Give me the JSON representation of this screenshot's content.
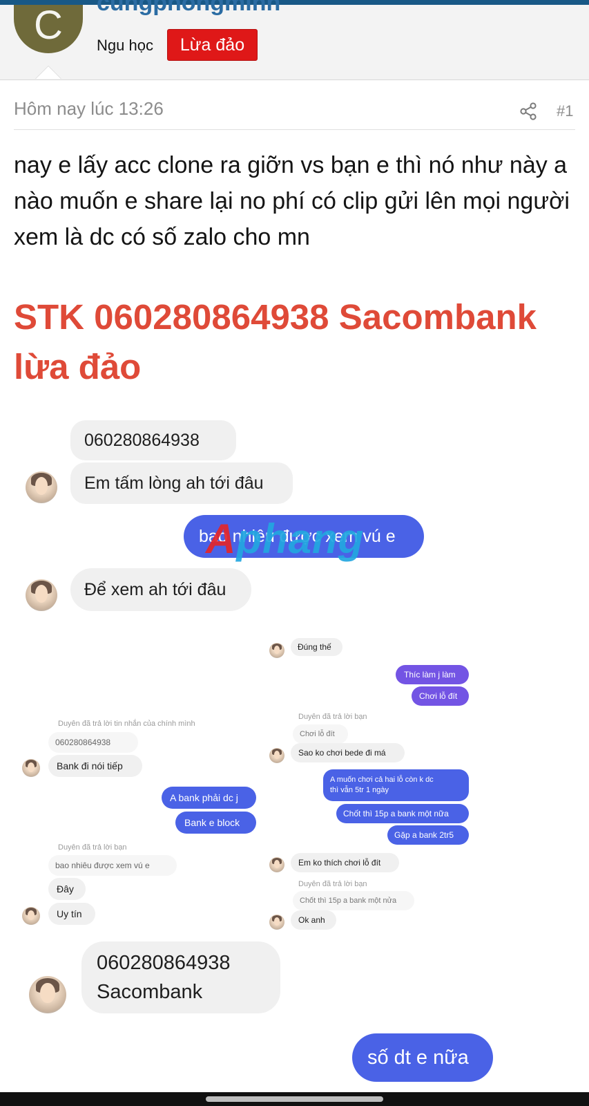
{
  "colors": {
    "topbar": "#185886",
    "badge": "#df1818",
    "headline": "#df4a38",
    "bubble_purple": "#7354e4",
    "bubble_blue": "#4a62e6",
    "bubble_gray": "#f0f0f0"
  },
  "user": {
    "avatar_letter": "C",
    "name": "cungphongminh",
    "title": "Ngu học",
    "badge": "Lừa đảo"
  },
  "post": {
    "timestamp": "Hôm nay lúc 13:26",
    "number": "#1",
    "body": "nay e lấy acc clone ra giỡn vs bạn e thì nó như này a nào muốn e share lại no phí có clip gửi lên mọi người xem là dc có số zalo cho mn",
    "headline": "STK 060280864938 Sacombank lừa đảo"
  },
  "chat": {
    "watermark_a": "A",
    "watermark_rest": "phang",
    "top": [
      {
        "text": "060280864938"
      },
      {
        "text": "Em tấm lòng ah tới đâu"
      },
      {
        "text": "bao nhiêu được xem vú e"
      },
      {
        "text": "Để xem ah tới đâu"
      }
    ],
    "right_col": {
      "first": "Đúng thế",
      "sent1": "Thíc làm j làm",
      "sent2": "Chơi lỗ đít",
      "reply_note1": "Duyên đã trả lời bạn",
      "quoted1": "Chơi lỗ đít",
      "recv1": "Sao ko chơi bede đi má",
      "sent3_line1": "A muốn chơi cả hai lỗ còn k dc",
      "sent3_line2": "thì vẫn 5tr 1 ngày",
      "sent4": "Chốt thì 15p a bank một nữa",
      "sent5": "Gặp a bank 2tr5",
      "recv2": "Em ko thích chơi lỗ đít",
      "reply_note2": "Duyên đã trả lời bạn",
      "quoted2": "Chốt thì 15p a bank một nửa",
      "recv3": "Ok anh"
    },
    "left_col": {
      "reply_note1": "Duyên đã trả lời tin nhắn của chính mình",
      "quoted1": "060280864938",
      "recv1": "Bank đi nói tiếp",
      "sent1": "A bank phải dc j",
      "sent2": "Bank e block",
      "reply_note2": "Duyên đã trả lời bạn",
      "quoted2": "bao nhiêu được xem vú e",
      "recv2": "Đây",
      "recv3": "Uy tín"
    },
    "bottom": {
      "line1": "060280864938",
      "line2": "Sacombank",
      "sent": "số dt e nữa"
    }
  }
}
